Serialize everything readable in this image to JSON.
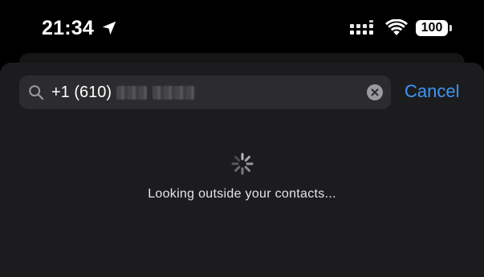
{
  "status_bar": {
    "time": "21:34",
    "location_icon": "location-arrow-icon",
    "signal_icon": "cellular-signal-icon",
    "wifi_icon": "wifi-icon",
    "battery_level": "100"
  },
  "search": {
    "value": "+1 (610)",
    "redacted": true,
    "search_icon": "search-icon",
    "clear_icon": "clear-icon",
    "cancel_label": "Cancel"
  },
  "loading": {
    "spinner_icon": "spinner-icon",
    "message": "Looking outside your contacts..."
  },
  "colors": {
    "background": "#000000",
    "sheet": "#1c1c1e",
    "search_field": "#2c2c2f",
    "accent": "#3e95f5",
    "text": "#ffffff"
  }
}
